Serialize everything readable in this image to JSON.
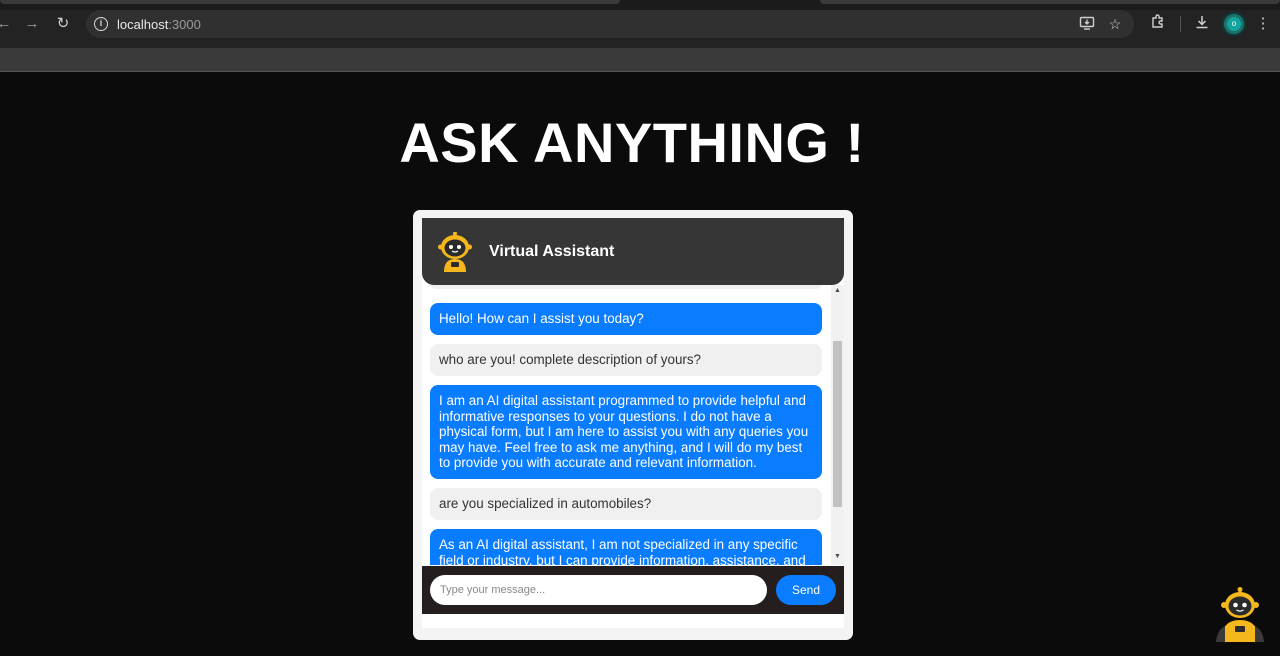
{
  "browser": {
    "url_host": "localhost",
    "url_port": ":3000",
    "profile_initial": "o"
  },
  "page": {
    "title": "ASK ANYTHING !"
  },
  "chat": {
    "header_title": "Virtual Assistant",
    "messages": [
      {
        "role": "bot",
        "text": "Hello! How can I assist you today?"
      },
      {
        "role": "user",
        "text": "who are you! complete description of yours?"
      },
      {
        "role": "bot",
        "text": "I am an AI digital assistant programmed to provide helpful and informative responses to your questions. I do not have a physical form, but I am here to assist you with any queries you may have. Feel free to ask me anything, and I will do my best to provide you with accurate and relevant information."
      },
      {
        "role": "user",
        "text": "are you specialized in automobiles?"
      },
      {
        "role": "bot",
        "text": "As an AI digital assistant, I am not specialized in any specific field or industry, but I can provide information, assistance, and"
      }
    ],
    "input_placeholder": "Type your message...",
    "send_label": "Send"
  },
  "colors": {
    "accent": "#0a7cff",
    "header_bg": "#363636",
    "page_bg": "#0b0b0b",
    "robot_yellow": "#f5b81c"
  },
  "icons": [
    "back-icon",
    "forward-icon",
    "reload-icon",
    "site-info-icon",
    "install-app-icon",
    "bookmark-star-icon",
    "extensions-icon",
    "download-icon",
    "menu-icon",
    "robot-icon"
  ]
}
